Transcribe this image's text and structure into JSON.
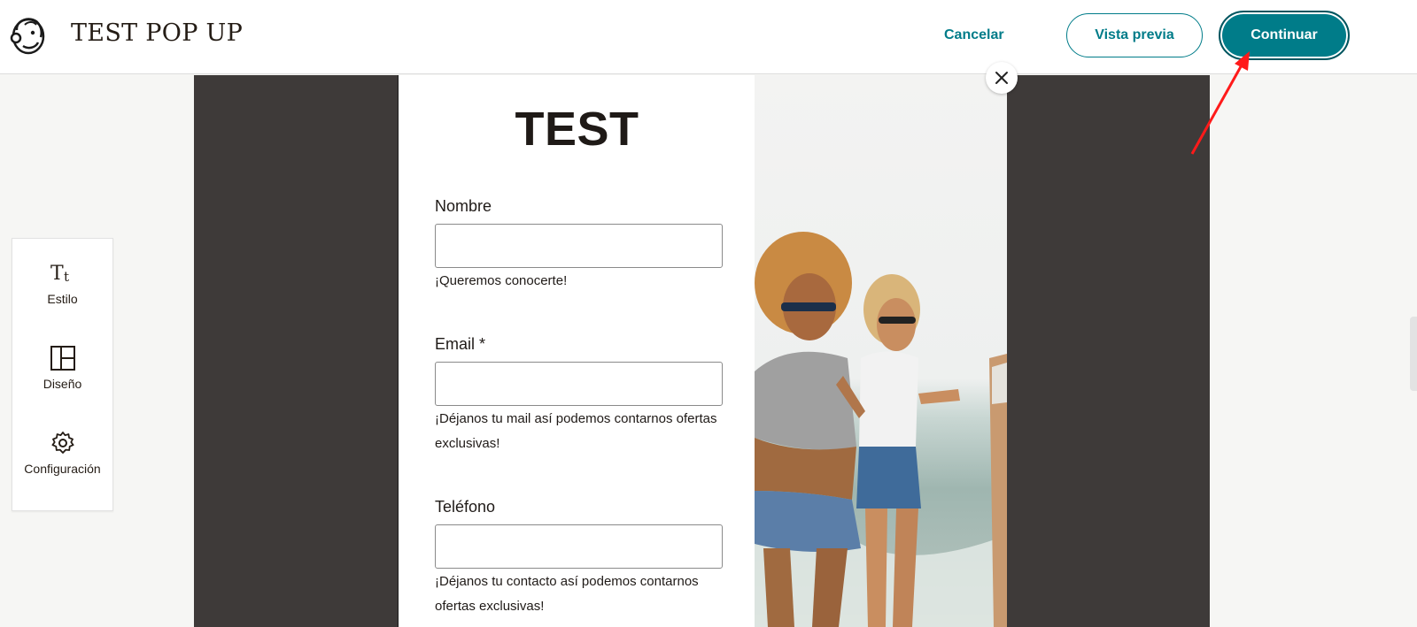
{
  "header": {
    "title": "TEST POP UP",
    "cancel_label": "Cancelar",
    "preview_label": "Vista previa",
    "continue_label": "Continuar"
  },
  "sidebar": {
    "items": [
      {
        "label": "Estilo",
        "icon": "text-style-icon"
      },
      {
        "label": "Diseño",
        "icon": "layout-icon"
      },
      {
        "label": "Configuración",
        "icon": "gear-icon"
      }
    ]
  },
  "popup": {
    "title": "TEST",
    "fields": [
      {
        "label": "Nombre",
        "value": "",
        "help": "¡Queremos conocerte!"
      },
      {
        "label": "Email *",
        "value": "",
        "help": "¡Déjanos tu mail así podemos contarnos ofertas exclusivas!"
      },
      {
        "label": "Teléfono",
        "value": "",
        "help": "¡Déjanos tu contacto así podemos contarnos ofertas exclusivas!"
      }
    ]
  },
  "colors": {
    "accent": "#007c89",
    "canvas": "#3e3a39",
    "annotation": "#ff1a1a"
  }
}
